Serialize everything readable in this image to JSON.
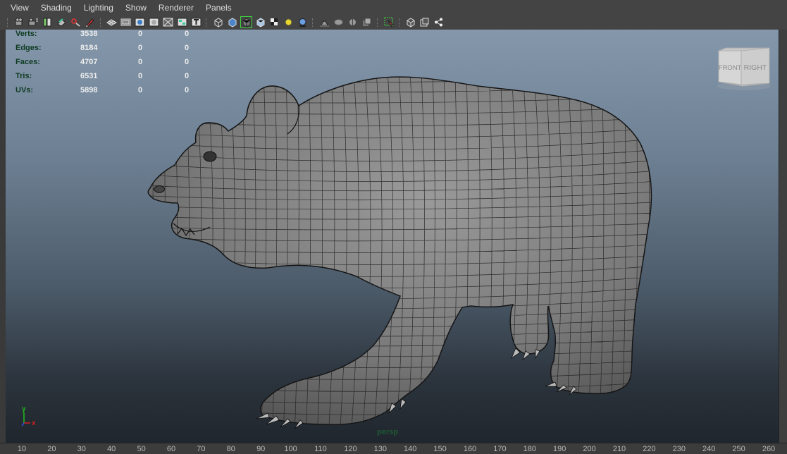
{
  "menu": [
    "View",
    "Shading",
    "Lighting",
    "Show",
    "Renderer",
    "Panels"
  ],
  "toolbar_icons": [
    "select-camera-icon",
    "camera-attributes-icon",
    "bookmark-icon",
    "image-plane-icon",
    "2d-pan-zoom-icon",
    "grease-pencil-icon",
    "grid-icon",
    "film-gate-icon",
    "resolution-gate-icon",
    "gate-mask-icon",
    "field-chart-icon",
    "safe-title-icon",
    "wireframe-icon",
    "smooth-shade-icon",
    "wireframe-on-shaded-icon",
    "xray-icon",
    "textured-icon",
    "use-all-lights-icon",
    "shadows-icon",
    "screen-space-ambient-occlusion-icon",
    "motion-blur-icon",
    "multisample-aa-icon",
    "depth-of-field-icon",
    "isolate-select-icon",
    "xray-joints-icon",
    "xray-active-icon",
    "share-icon"
  ],
  "hud": {
    "rows": [
      {
        "label": "Verts:",
        "v1": "3538",
        "v2": "0",
        "v3": "0"
      },
      {
        "label": "Edges:",
        "v1": "8184",
        "v2": "0",
        "v3": "0"
      },
      {
        "label": "Faces:",
        "v1": "4707",
        "v2": "0",
        "v3": "0"
      },
      {
        "label": "Tris:",
        "v1": "6531",
        "v2": "0",
        "v3": "0"
      },
      {
        "label": "UVs:",
        "v1": "5898",
        "v2": "0",
        "v3": "0"
      }
    ]
  },
  "viewcube": {
    "front": "FRONT",
    "right": "RIGHT"
  },
  "axis": {
    "y": "y",
    "x": "x"
  },
  "camera": "persp",
  "ruler": [
    "10",
    "20",
    "30",
    "40",
    "50",
    "60",
    "70",
    "80",
    "90",
    "100",
    "110",
    "120",
    "130",
    "140",
    "150",
    "160",
    "170",
    "180",
    "190",
    "200",
    "210",
    "220",
    "230",
    "240",
    "250",
    "260"
  ],
  "colors": {
    "hud_label": "#0d3a1f",
    "camera_label": "#1e5a34",
    "mesh": "#7c7c7c",
    "wire": "#1a1a1a",
    "axis_x": "#d32020",
    "axis_y": "#20c020",
    "axis_z": "#3050e0"
  }
}
